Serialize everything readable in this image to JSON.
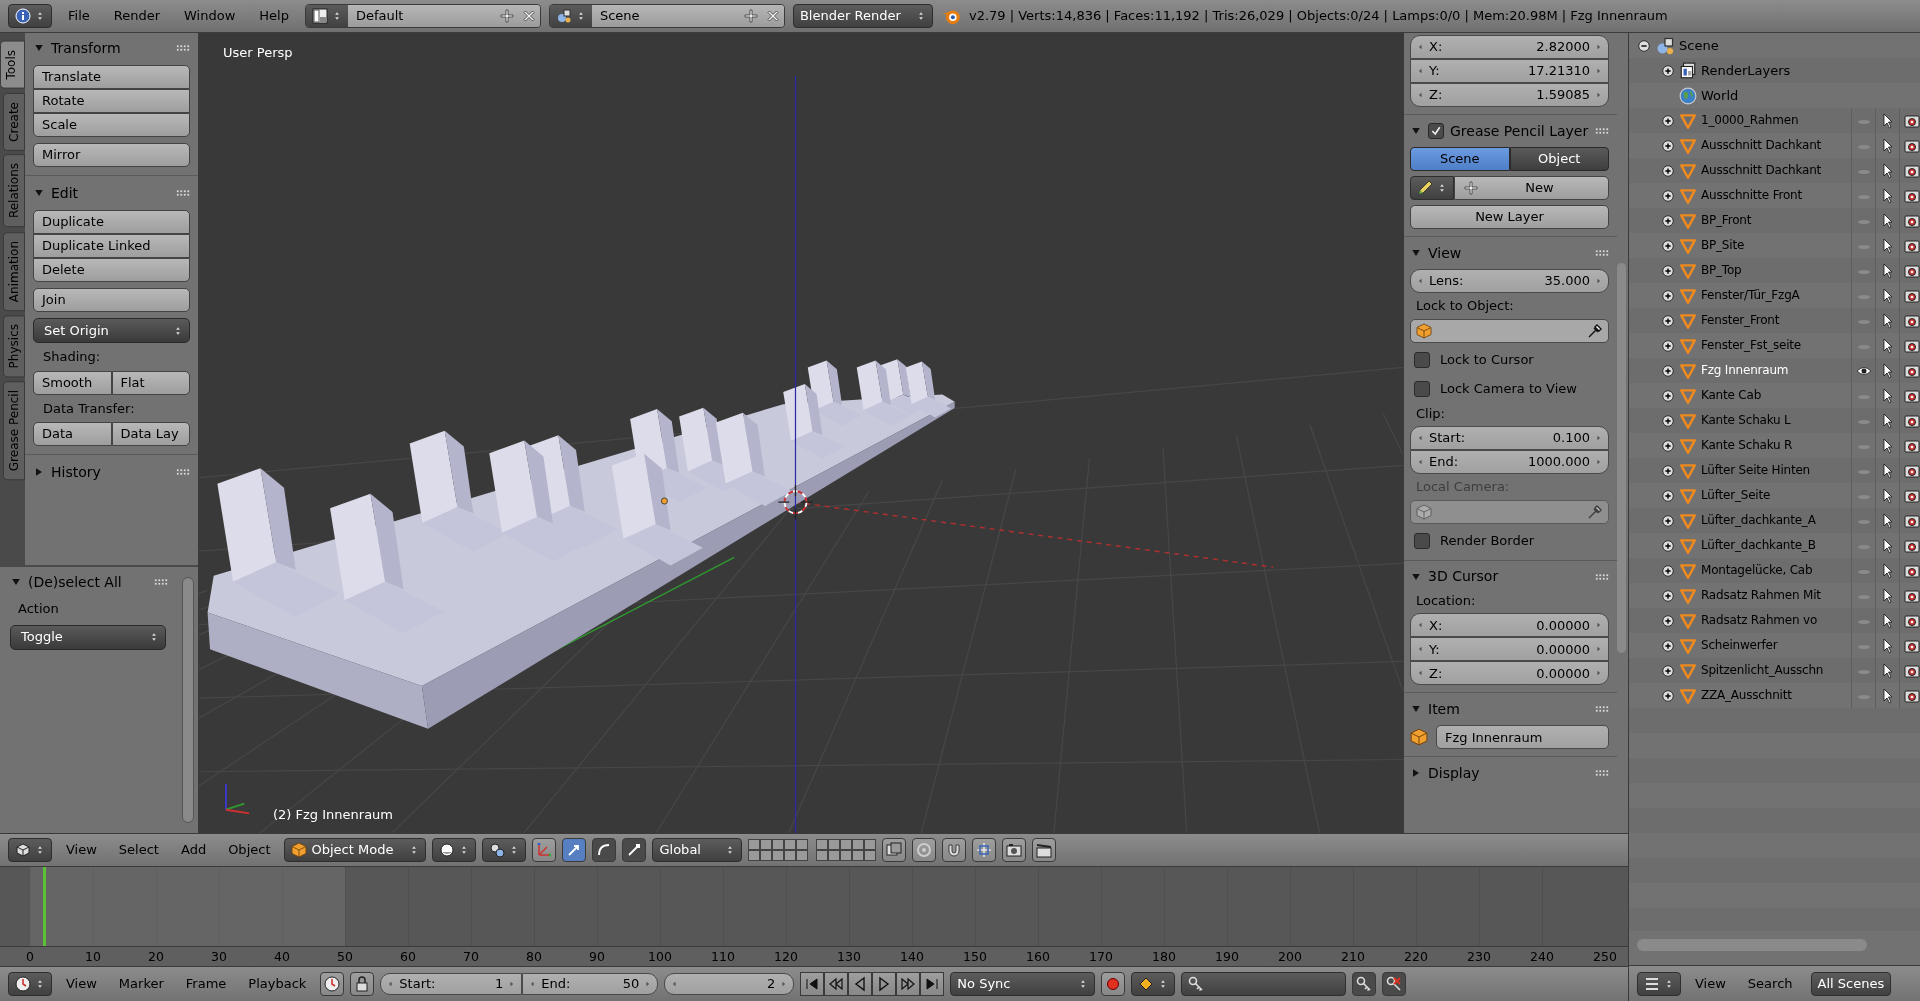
{
  "top_bar": {
    "menus": [
      "File",
      "Render",
      "Window",
      "Help"
    ],
    "screen": "Default",
    "scene": "Scene",
    "engine": "Blender Render",
    "stats": "v2.79 | Verts:14,836 | Faces:11,192 | Tris:26,029 | Objects:0/24 | Lamps:0/0 | Mem:20.98M | Fzg Innenraum"
  },
  "tool_shelf": {
    "tabs": [
      {
        "label": "Tools",
        "selected": true
      },
      {
        "label": "Create",
        "selected": false
      },
      {
        "label": "Relations",
        "selected": false
      },
      {
        "label": "Animation",
        "selected": false
      },
      {
        "label": "Physics",
        "selected": false
      },
      {
        "label": "Grease Pencil",
        "selected": false
      }
    ],
    "panels": [
      {
        "title": "Transform",
        "expanded": true,
        "items": [
          {
            "kind": "stack",
            "labels": [
              "Translate",
              "Rotate",
              "Scale"
            ]
          },
          {
            "kind": "stack",
            "labels": [
              "Mirror"
            ]
          }
        ]
      },
      {
        "title": "Edit",
        "expanded": true,
        "items": [
          {
            "kind": "stack",
            "labels": [
              "Duplicate",
              "Duplicate Linked",
              "Delete"
            ]
          },
          {
            "kind": "stack",
            "labels": [
              "Join"
            ]
          },
          {
            "kind": "dropdown",
            "value": "Set Origin"
          },
          {
            "kind": "label",
            "text": "Shading:"
          },
          {
            "kind": "pair",
            "labels": [
              "Smooth",
              "Flat"
            ]
          },
          {
            "kind": "label",
            "text": "Data Transfer:"
          },
          {
            "kind": "pair",
            "labels": [
              "Data",
              "Data Lay"
            ]
          }
        ]
      },
      {
        "title": "History",
        "expanded": false
      }
    ]
  },
  "redo_panel": {
    "title": "(De)select All",
    "expanded": true,
    "label": "Action",
    "value": "Toggle"
  },
  "viewport": {
    "view_name": "User Persp",
    "object_info": "(2) Fzg Innenraum"
  },
  "properties": {
    "panels": [
      {
        "items": [
          {
            "kind": "fields",
            "rows": [
              {
                "label": "X:",
                "value": "2.82000"
              },
              {
                "label": "Y:",
                "value": "17.21310"
              },
              {
                "label": "Z:",
                "value": "1.59085"
              }
            ]
          }
        ]
      },
      {
        "title": "Grease Pencil Layer",
        "expanded": true,
        "checked": true,
        "items": [
          {
            "kind": "segmented",
            "options": [
              {
                "label": "Scene",
                "selected": true
              },
              {
                "label": "Object",
                "selected": false
              }
            ]
          },
          {
            "kind": "new",
            "label": "New"
          },
          {
            "kind": "button",
            "label": "New Layer"
          }
        ]
      },
      {
        "title": "View",
        "expanded": true,
        "items": [
          {
            "kind": "fields",
            "rows": [
              {
                "label": "Lens:",
                "value": "35.000"
              }
            ]
          },
          {
            "kind": "label",
            "text": "Lock to Object:",
            "disabled": false
          },
          {
            "kind": "picker",
            "disabled": false
          },
          {
            "kind": "checkbox",
            "label": "Lock to Cursor",
            "checked": false
          },
          {
            "kind": "checkbox",
            "label": "Lock Camera to View",
            "checked": false
          },
          {
            "kind": "label",
            "text": "Clip:",
            "disabled": false
          },
          {
            "kind": "fields",
            "rows": [
              {
                "label": "Start:",
                "value": "0.100"
              },
              {
                "label": "End:",
                "value": "1000.000"
              }
            ]
          },
          {
            "kind": "label",
            "text": "Local Camera:",
            "disabled": true
          },
          {
            "kind": "picker",
            "disabled": true
          },
          {
            "kind": "checkbox",
            "label": "Render Border",
            "checked": false
          }
        ]
      },
      {
        "title": "3D Cursor",
        "expanded": true,
        "items": [
          {
            "kind": "label",
            "text": "Location:",
            "disabled": false
          },
          {
            "kind": "fields",
            "rows": [
              {
                "label": "X:",
                "value": "0.00000"
              },
              {
                "label": "Y:",
                "value": "0.00000"
              },
              {
                "label": "Z:",
                "value": "0.00000"
              }
            ]
          }
        ]
      },
      {
        "title": "Item",
        "expanded": true,
        "items": [
          {
            "kind": "object_name",
            "value": "Fzg Innenraum"
          }
        ]
      },
      {
        "title": "Display",
        "expanded": false
      }
    ]
  },
  "view3d_header": {
    "menus": [
      "View",
      "Select",
      "Add",
      "Object"
    ],
    "mode": "Object Mode",
    "orientation": "Global"
  },
  "timeline": {
    "ruler": [
      "0",
      "10",
      "20",
      "30",
      "40",
      "50",
      "60",
      "70",
      "80",
      "90",
      "100",
      "110",
      "120",
      "130",
      "140",
      "150",
      "160",
      "170",
      "180",
      "190",
      "200",
      "210",
      "220",
      "230",
      "240",
      "250"
    ],
    "preview_range": {
      "level": 0.2
    },
    "playhead": {
      "level": 0.008
    }
  },
  "timeline_header": {
    "menus": [
      "View",
      "Marker",
      "Frame",
      "Playback"
    ],
    "start_label": "Start:",
    "start": "1",
    "end_label": "End:",
    "end": "50",
    "frame": "2",
    "sync": "No Sync"
  },
  "outliner": {
    "tree": [
      {
        "name": "Scene",
        "kind": "scene",
        "expanded": true,
        "children": [
          {
            "name": "RenderLayers",
            "kind": "renderlayers",
            "expanded": false
          },
          {
            "name": "World",
            "kind": "world"
          },
          {
            "name": "1_0000_Rahmen",
            "kind": "object",
            "expanded": false,
            "selected": false,
            "visible": false
          },
          {
            "name": "Ausschnitt Dachkant",
            "kind": "object",
            "expanded": false,
            "selected": false,
            "visible": false
          },
          {
            "name": "Ausschnitt Dachkant",
            "kind": "object",
            "expanded": false,
            "selected": false,
            "visible": false
          },
          {
            "name": "Ausschnitte Front",
            "kind": "object",
            "expanded": false,
            "selected": false,
            "visible": false
          },
          {
            "name": "BP_Front",
            "kind": "object",
            "expanded": false,
            "selected": false,
            "visible": false
          },
          {
            "name": "BP_Site",
            "kind": "object",
            "expanded": false,
            "selected": false,
            "visible": false
          },
          {
            "name": "BP_Top",
            "kind": "object",
            "expanded": false,
            "selected": false,
            "visible": false
          },
          {
            "name": "Fenster/Tür_FzgA",
            "kind": "object",
            "expanded": false,
            "selected": false,
            "visible": false
          },
          {
            "name": "Fenster_Front",
            "kind": "object",
            "expanded": false,
            "selected": false,
            "visible": false
          },
          {
            "name": "Fenster_Fst_seite",
            "kind": "object",
            "expanded": false,
            "selected": false,
            "visible": false
          },
          {
            "name": "Fzg Innenraum",
            "kind": "object",
            "expanded": false,
            "selected": true,
            "visible": true
          },
          {
            "name": "Kante Cab",
            "kind": "object",
            "expanded": false,
            "selected": false,
            "visible": false
          },
          {
            "name": "Kante Schaku L",
            "kind": "object",
            "expanded": false,
            "selected": false,
            "visible": false
          },
          {
            "name": "Kante Schaku R",
            "kind": "object",
            "expanded": false,
            "selected": false,
            "visible": false
          },
          {
            "name": "Lüfter Seite Hinten",
            "kind": "object",
            "expanded": false,
            "selected": false,
            "visible": false
          },
          {
            "name": "Lüfter_Seite",
            "kind": "object",
            "expanded": false,
            "selected": false,
            "visible": false
          },
          {
            "name": "Lüfter_dachkante_A",
            "kind": "object",
            "expanded": false,
            "selected": false,
            "visible": false
          },
          {
            "name": "Lüfter_dachkante_B",
            "kind": "object",
            "expanded": false,
            "selected": false,
            "visible": false
          },
          {
            "name": "Montagelücke, Cab",
            "kind": "object",
            "expanded": false,
            "selected": false,
            "visible": false
          },
          {
            "name": "Radsatz Rahmen Mit",
            "kind": "object",
            "expanded": false,
            "selected": false,
            "visible": false
          },
          {
            "name": "Radsatz Rahmen vo",
            "kind": "object",
            "expanded": false,
            "selected": false,
            "visible": false
          },
          {
            "name": "Scheinwerfer",
            "kind": "object",
            "expanded": false,
            "selected": false,
            "visible": false
          },
          {
            "name": "Spitzenlicht_Ausschn",
            "kind": "object",
            "expanded": false,
            "selected": false,
            "visible": false
          },
          {
            "name": "ZZA_Ausschnitt",
            "kind": "object",
            "expanded": false,
            "selected": false,
            "visible": false
          }
        ]
      }
    ],
    "header": {
      "menus": [
        "View",
        "Search"
      ],
      "filter": "All Scenes"
    }
  }
}
